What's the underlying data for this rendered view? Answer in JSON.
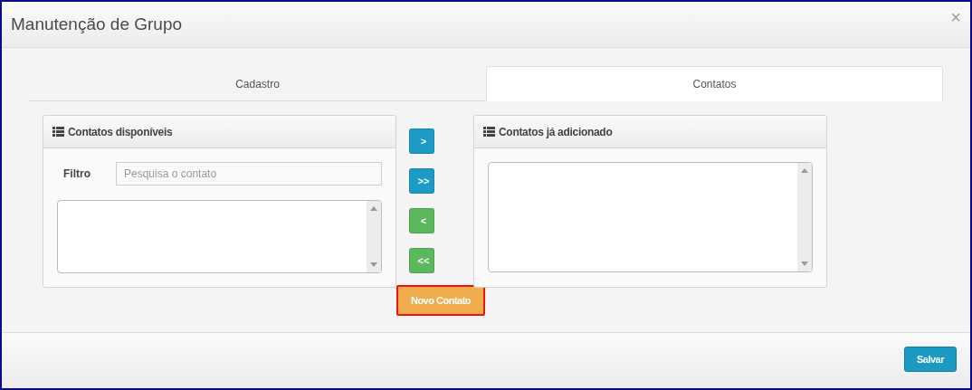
{
  "dialog": {
    "title": "Manutenção de Grupo",
    "close": "×"
  },
  "tabs": [
    {
      "label": "Cadastro",
      "selected": false
    },
    {
      "label": "Contatos",
      "selected": true
    }
  ],
  "available_panel": {
    "title": "Contatos disponíveis",
    "filter_label": "Filtro",
    "filter_placeholder": "Pesquisa o contato"
  },
  "transfer_buttons": [
    {
      "label": ">",
      "kind": "info"
    },
    {
      "label": ">>",
      "kind": "info"
    },
    {
      "label": "<",
      "kind": "success"
    },
    {
      "label": "<<",
      "kind": "success"
    }
  ],
  "new_contact_button": {
    "label": "Novo Contato",
    "highlighted": true
  },
  "added_panel": {
    "title": "Contatos já adicionado"
  },
  "footer": {
    "save_button": "Salvar"
  }
}
